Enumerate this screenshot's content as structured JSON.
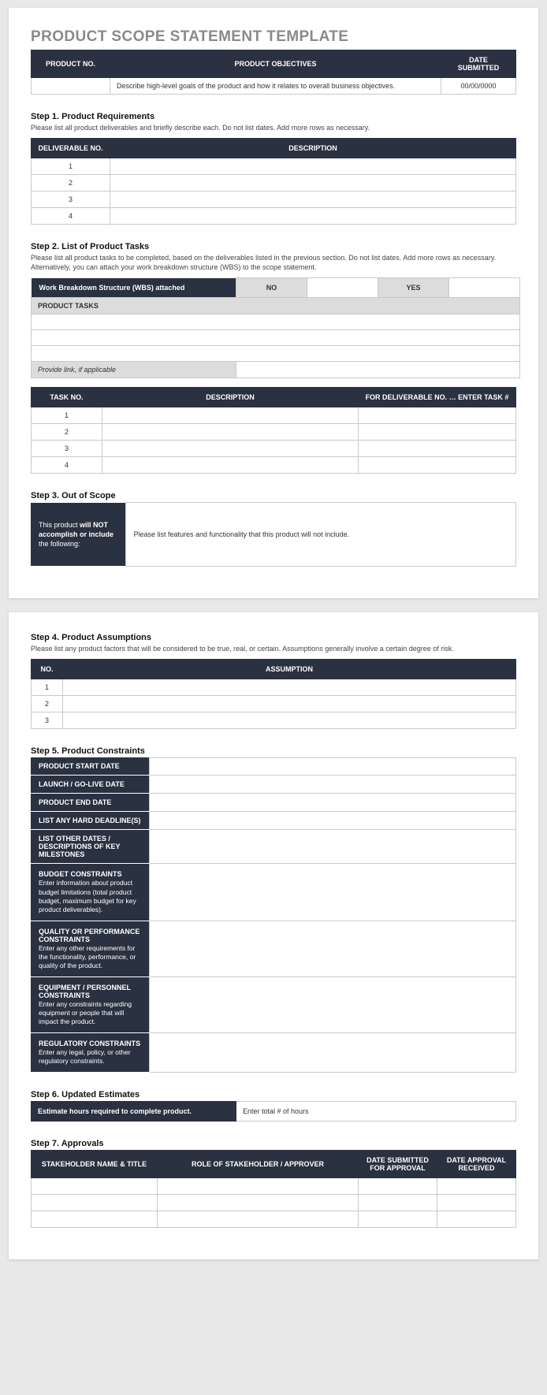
{
  "title": "PRODUCT SCOPE STATEMENT TEMPLATE",
  "header_table": {
    "h1": "PRODUCT NO.",
    "h2": "PRODUCT OBJECTIVES",
    "h3": "DATE SUBMITTED",
    "obj_text": "Describe high-level goals of the product and how it relates to overall business objectives.",
    "date": "00/00/0000"
  },
  "step1": {
    "title": "Step 1. Product Requirements",
    "sub": "Please list all product deliverables and briefly describe each. Do not list dates. Add more rows as necessary.",
    "h1": "DELIVERABLE NO.",
    "h2": "DESCRIPTION",
    "rows": [
      "1",
      "2",
      "3",
      "4"
    ]
  },
  "step2": {
    "title": "Step 2. List of Product Tasks",
    "sub": "Please list all product tasks to be completed, based on the deliverables listed in the previous section. Do not list dates. Add more rows as necessary. Alternatively, you can attach your work breakdown structure (WBS) to the scope statement.",
    "wbs_label": "Work Breakdown Structure (WBS) attached",
    "no": "NO",
    "yes": "YES",
    "pt": "PRODUCT TASKS",
    "link": "Provide link, if applicable",
    "h1": "TASK NO.",
    "h2": "DESCRIPTION",
    "h3": "FOR DELIVERABLE NO. … ENTER TASK #",
    "rows": [
      "1",
      "2",
      "3",
      "4"
    ]
  },
  "step3": {
    "title": "Step 3. Out of Scope",
    "label_pre": "This product ",
    "label_bold": "will NOT accomplish or include",
    "label_post": " the following:",
    "text": "Please list features and functionality that this product will not include."
  },
  "step4": {
    "title": "Step 4. Product Assumptions",
    "sub": "Please list any product factors that will be considered to be true, real, or certain. Assumptions generally involve a certain degree of risk.",
    "h1": "NO.",
    "h2": "ASSUMPTION",
    "rows": [
      "1",
      "2",
      "3"
    ]
  },
  "step5": {
    "title": "Step 5. Product Constraints",
    "rows": [
      {
        "strong": "PRODUCT START DATE",
        "sub": ""
      },
      {
        "strong": "LAUNCH / GO-LIVE DATE",
        "sub": ""
      },
      {
        "strong": "PRODUCT END DATE",
        "sub": ""
      },
      {
        "strong": "LIST ANY HARD DEADLINE(S)",
        "sub": ""
      },
      {
        "strong": "LIST OTHER DATES / DESCRIPTIONS OF KEY MILESTONES",
        "sub": ""
      },
      {
        "strong": "BUDGET CONSTRAINTS",
        "sub": "Enter information about product budget limitations (total product budget, maximum budget for key product deliverables)."
      },
      {
        "strong": "QUALITY OR PERFORMANCE CONSTRAINTS",
        "sub": "Enter any other requirements for the functionality, performance, or quality of the product."
      },
      {
        "strong": "EQUIPMENT / PERSONNEL CONSTRAINTS",
        "sub": "Enter any constraints regarding equipment or people that will impact the product."
      },
      {
        "strong": "REGULATORY CONSTRAINTS",
        "sub": "Enter any legal, policy, or other regulatory constraints."
      }
    ]
  },
  "step6": {
    "title": "Step 6. Updated Estimates",
    "label": "Estimate hours required to complete product.",
    "placeholder": "Enter total # of hours"
  },
  "step7": {
    "title": "Step 7. Approvals",
    "h1": "STAKEHOLDER NAME & TITLE",
    "h2": "ROLE OF STAKEHOLDER / APPROVER",
    "h3": "DATE SUBMITTED FOR APPROVAL",
    "h4": "DATE APPROVAL RECEIVED"
  }
}
